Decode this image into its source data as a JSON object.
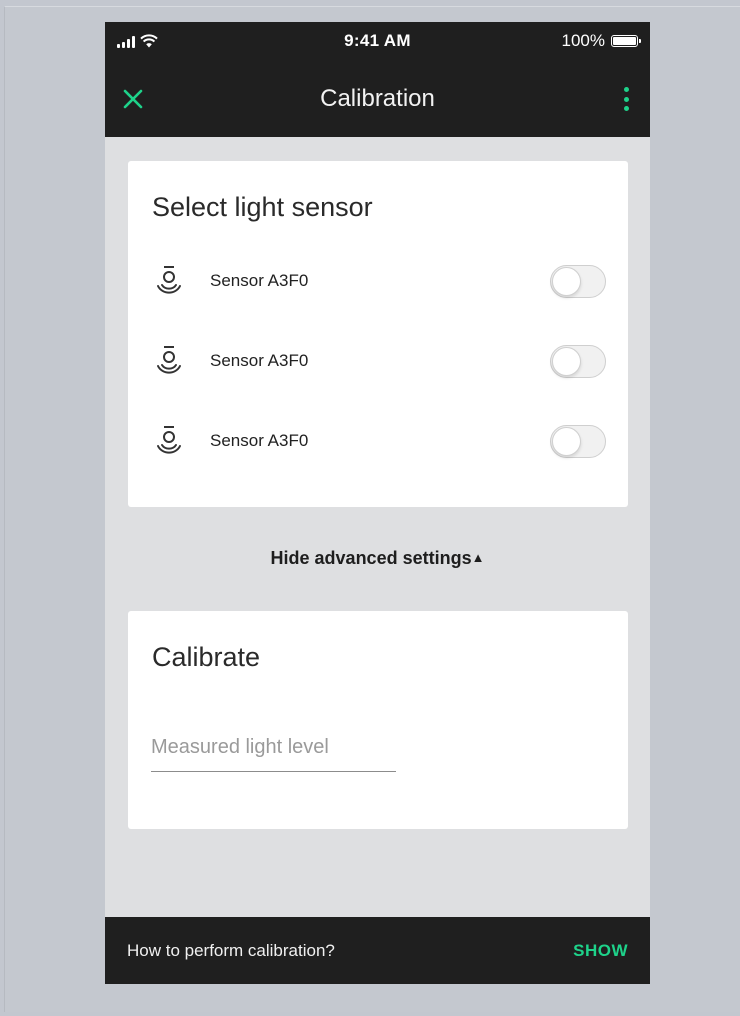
{
  "status_bar": {
    "time": "9:41 AM",
    "battery": "100%"
  },
  "app_bar": {
    "title": "Calibration",
    "close_icon": "close-icon",
    "more_icon": "more-vertical-icon"
  },
  "sensor_card": {
    "title": "Select light sensor",
    "sensors": [
      {
        "label": "Sensor A3F0",
        "icon": "light-sensor-icon",
        "enabled": false
      },
      {
        "label": "Sensor A3F0",
        "icon": "light-sensor-icon",
        "enabled": false
      },
      {
        "label": "Sensor A3F0",
        "icon": "light-sensor-icon",
        "enabled": false
      }
    ]
  },
  "advanced": {
    "label": "Hide advanced settings",
    "caret": "▲"
  },
  "calibrate_card": {
    "title": "Calibrate",
    "input_placeholder": "Measured light level",
    "input_value": ""
  },
  "snackbar": {
    "message": "How to perform calibration?",
    "action": "SHOW"
  },
  "colors": {
    "accent": "#1ed28a",
    "bar_background": "#1f1f1f",
    "page_background": "#dedfe1",
    "card_background": "#ffffff"
  }
}
